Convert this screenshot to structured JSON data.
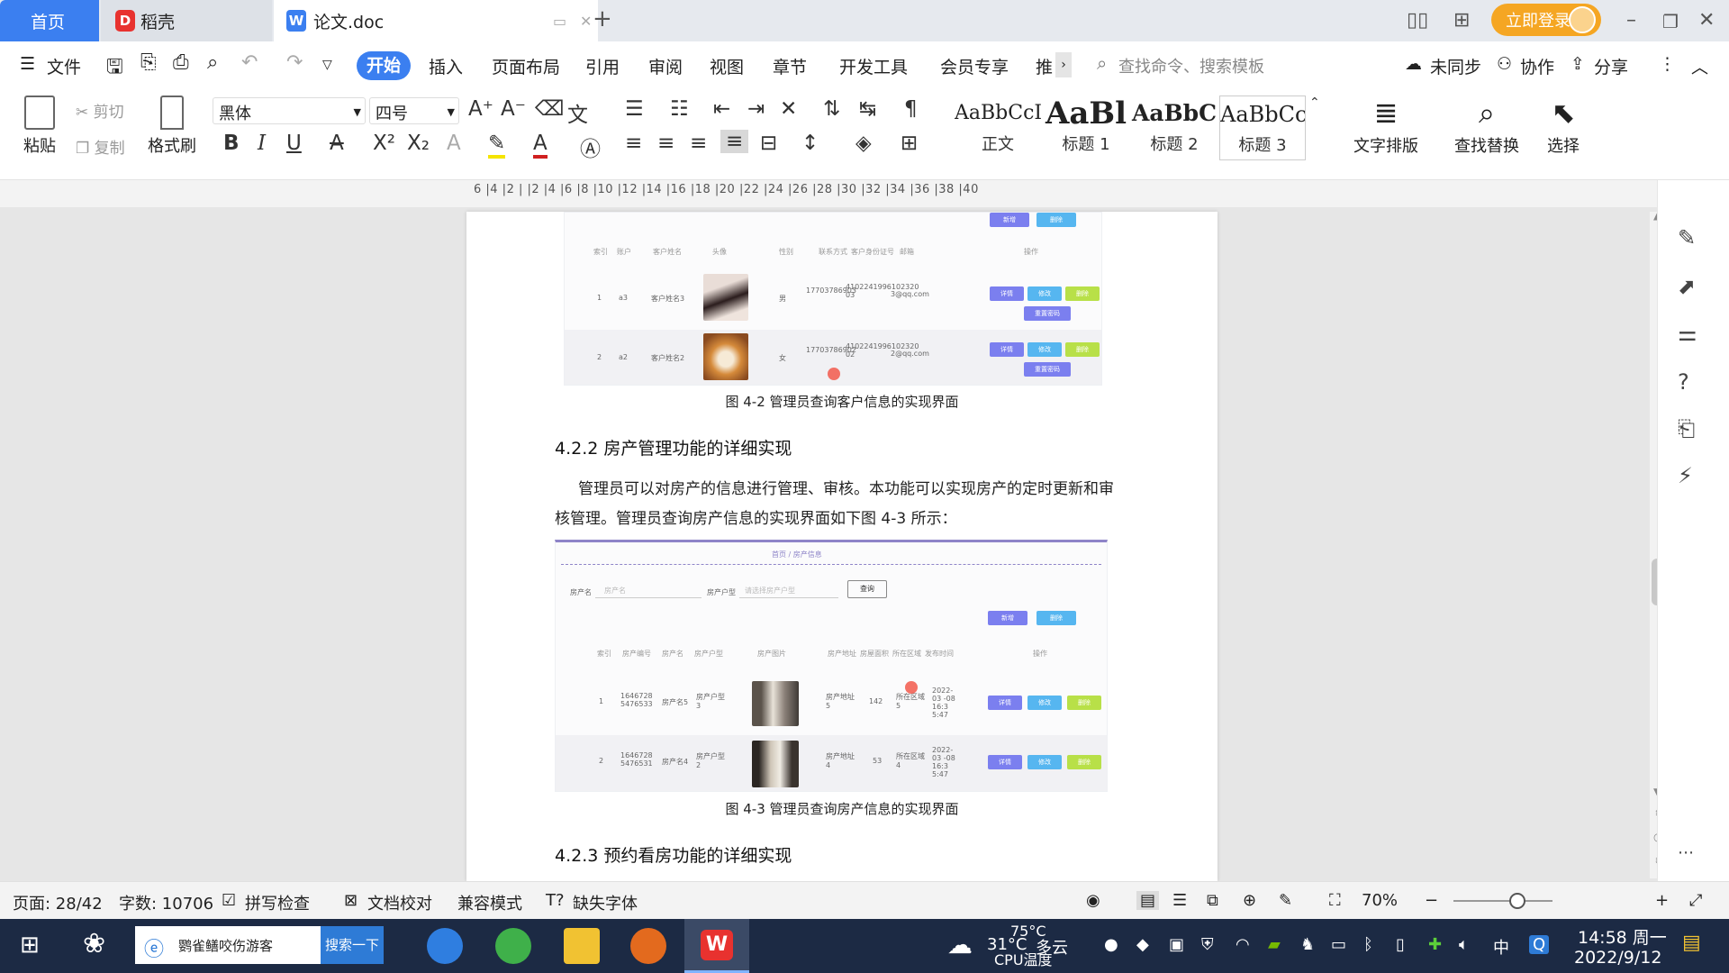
{
  "titlebar": {
    "tab_home": "首页",
    "tab_docer": "稻壳",
    "tab_doc": "论文.doc",
    "login": "立即登录"
  },
  "menubar": {
    "file": "文件",
    "items": [
      "开始",
      "插入",
      "页面布局",
      "引用",
      "审阅",
      "视图",
      "章节",
      "开发工具",
      "会员专享",
      "推"
    ],
    "search_placeholder": "查找命令、搜索模板",
    "unsynced": "未同步",
    "collab": "协作",
    "share": "分享"
  },
  "ribbon": {
    "paste": "粘贴",
    "cut": "剪切",
    "copy": "复制",
    "format_painter": "格式刷",
    "font": "黑体",
    "size": "四号",
    "styles": [
      {
        "preview": "AaBbCcI",
        "label": "正文"
      },
      {
        "preview": "AaBl",
        "label": "标题 1"
      },
      {
        "preview": "AaBbC",
        "label": "标题 2"
      },
      {
        "preview": "AaBbCc",
        "label": "标题 3"
      }
    ],
    "text_layout": "文字排版",
    "find_replace": "查找替换",
    "select": "选择"
  },
  "ruler": {
    "ticks": "6 |4 |2 | |2 |4 |6 |8 |10 |12 |14 |16 |18 |20 |22 |24 |26 |28 |30 |32 |34 |36 |38 |40"
  },
  "document": {
    "shot1": {
      "headers": [
        "索引",
        "账户",
        "客户姓名",
        "头像",
        "性别",
        "联系方式",
        "客户身份证号",
        "邮箱",
        "操作"
      ],
      "rows": [
        {
          "idx": "1",
          "acct": "a3",
          "name": "客户姓名3",
          "gender": "男",
          "phone": "17703786903",
          "idno": "4102241996102320 03",
          "email": "3@qq.com"
        },
        {
          "idx": "2",
          "acct": "a2",
          "name": "客户姓名2",
          "gender": "女",
          "phone": "17703786902",
          "idno": "4102241996102320 02",
          "email": "2@qq.com"
        }
      ],
      "top_buttons": [
        "新增",
        "删除"
      ],
      "btn_detail": "详情",
      "btn_edit": "修改",
      "btn_delete": "删除",
      "btn_reset": "重置密码"
    },
    "caption1": "图 4-2 管理员查询客户信息的实现界面",
    "heading1": "4.2.2 房产管理功能的详细实现",
    "para_line1": "管理员可以对房产的信息进行管理、审核。本功能可以实现房产的定时更新和审",
    "para_line2": "核管理。管理员查询房产信息的实现界面如下图 4-3 所示：",
    "shot2": {
      "breadcrumb": "首页 / 房产信息",
      "filter_name_label": "房产名",
      "filter_name_placeholder": "房产名",
      "filter_type_label": "房产户型",
      "filter_type_placeholder": "请选择房产户型",
      "query": "查询",
      "add": "新增",
      "delete": "删除",
      "headers": [
        "索引",
        "房产编号",
        "房产名",
        "房产户型",
        "房产图片",
        "房产地址",
        "房屋面积",
        "所在区域",
        "发布时间",
        "操作"
      ],
      "rows": [
        {
          "idx": "1",
          "no": "1646728 5476533",
          "name": "房产名5",
          "type": "房产户型 3",
          "addr": "房产地址 5",
          "area": "142",
          "region": "所在区域 5",
          "time": "2022-03 -08 16:3 5:47"
        },
        {
          "idx": "2",
          "no": "1646728 5476531",
          "name": "房产名4",
          "type": "房产户型 2",
          "addr": "房产地址 4",
          "area": "53",
          "region": "所在区域 4",
          "time": "2022-03 -08 16:3 5:47"
        }
      ],
      "btn_detail": "详情",
      "btn_edit": "修改",
      "btn_delete": "删除"
    },
    "caption2": "图 4-3 管理员查询房产信息的实现界面",
    "heading2": "4.2.3 预约看房功能的详细实现"
  },
  "statusbar": {
    "page": "页面: 28/42",
    "words": "字数: 10706",
    "spell": "拼写检查",
    "proof": "文档校对",
    "compat": "兼容模式",
    "missing_font": "缺失字体",
    "zoom": "70%"
  },
  "taskbar": {
    "search_text": "鹦雀鳝咬伤游客",
    "search_btn": "搜索一下",
    "weather_temp": "31°C",
    "weather_desc": "多云",
    "cpu_temp": "75°C",
    "cpu_label": "CPU温度",
    "ime": "中",
    "time": "14:58 周一",
    "date": "2022/9/12"
  },
  "colors": {
    "accent": "#3b7ff0",
    "login": "#f5a623",
    "taskbar": "#1c2a44"
  }
}
